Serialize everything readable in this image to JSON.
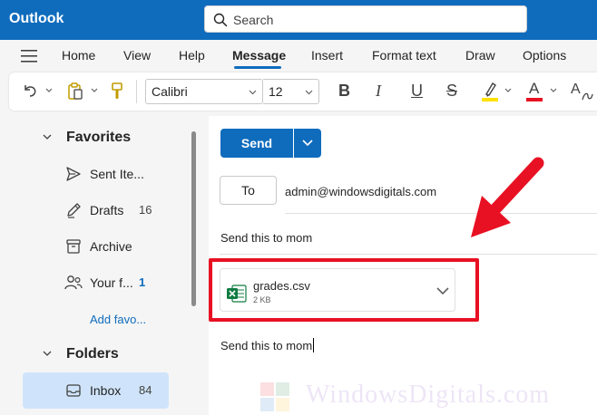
{
  "app": {
    "title": "Outlook"
  },
  "search": {
    "label": "Search"
  },
  "tabs": [
    {
      "label": "Home"
    },
    {
      "label": "View"
    },
    {
      "label": "Help"
    },
    {
      "label": "Message",
      "active": true
    },
    {
      "label": "Insert"
    },
    {
      "label": "Format text"
    },
    {
      "label": "Draw"
    },
    {
      "label": "Options"
    }
  ],
  "ribbon": {
    "font_name": "Calibri",
    "font_size": "12",
    "bold": "B",
    "italic": "I",
    "underline": "U",
    "strike": "S",
    "font_color_letter": "A",
    "styles_label": "A",
    "highlight_color": "#ffe100",
    "font_color": "#e81123"
  },
  "sidebar": {
    "favorites_title": "Favorites",
    "folders_title": "Folders",
    "add_favorite": "Add favo...",
    "favorites": [
      {
        "label": "Sent Ite...",
        "icon": "send-icon",
        "count": ""
      },
      {
        "label": "Drafts",
        "icon": "pencil-icon",
        "count": "16"
      },
      {
        "label": "Archive",
        "icon": "archive-icon",
        "count": ""
      },
      {
        "label": "Your f...",
        "icon": "people-icon",
        "count": "1"
      }
    ],
    "folders": [
      {
        "label": "Inbox",
        "icon": "inbox-icon",
        "count": "84",
        "selected": true
      }
    ]
  },
  "compose": {
    "send_label": "Send",
    "to_label": "To",
    "to_value": "admin@windowsdigitals.com",
    "subject": "Send this to mom",
    "body": "Send this to mom",
    "attachment": {
      "name": "grades.csv",
      "size": "2 KB"
    }
  },
  "watermark": {
    "text": "WindowsDigitals.com"
  },
  "colors": {
    "accent": "#0f6cbd",
    "annotation": "#e81123",
    "selected": "#cfe4fa"
  }
}
